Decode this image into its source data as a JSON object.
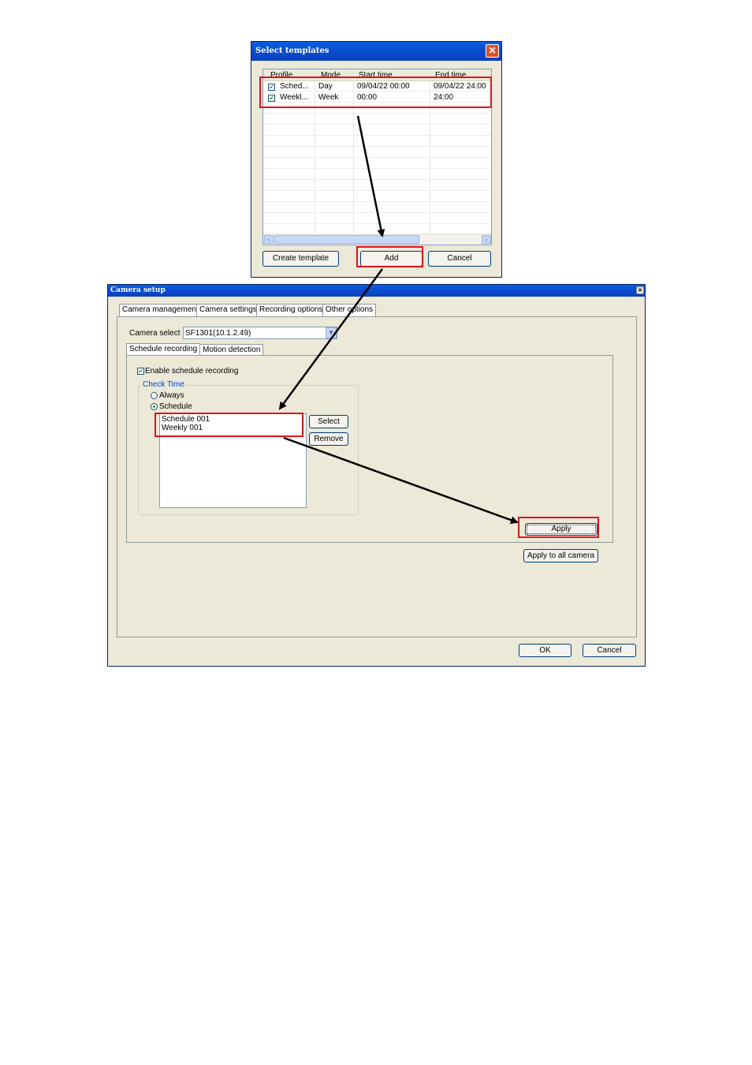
{
  "select_templates": {
    "title": "Select templates",
    "columns": [
      "Profile",
      "Mode",
      "Start time",
      "End time"
    ],
    "rows": [
      {
        "profile": "Sched...",
        "mode": "Day",
        "start": "09/04/22 00:00",
        "end": "09/04/22 24:00",
        "checked": true
      },
      {
        "profile": "Weekl...",
        "mode": "Week",
        "start": "00:00",
        "end": "24:00",
        "checked": true
      }
    ],
    "buttons": {
      "create": "Create template",
      "add": "Add",
      "cancel": "Cancel"
    }
  },
  "camera_setup": {
    "title": "Camera setup",
    "tabs": [
      "Camera management",
      "Camera settings",
      "Recording options",
      "Other options"
    ],
    "camera_select_label": "Camera select",
    "camera_select_value": "SF1301(10.1.2.49)",
    "subtabs": [
      "Schedule recording",
      "Motion detection"
    ],
    "enable_label": "Enable schedule recording",
    "check_time_label": "Check Time",
    "radio_always": "Always",
    "radio_schedule": "Schedule",
    "schedule_list": [
      "Schedule 001",
      "Weekly 001"
    ],
    "btn_select": "Select",
    "btn_remove": "Remove",
    "btn_apply": "Apply",
    "btn_apply_all": "Apply to all camera",
    "btn_ok": "OK",
    "btn_cancel": "Cancel"
  },
  "colors": {
    "highlight": "#e0141e",
    "titlebar": "#0a4fd0",
    "dialog_bg": "#ece9d8"
  }
}
